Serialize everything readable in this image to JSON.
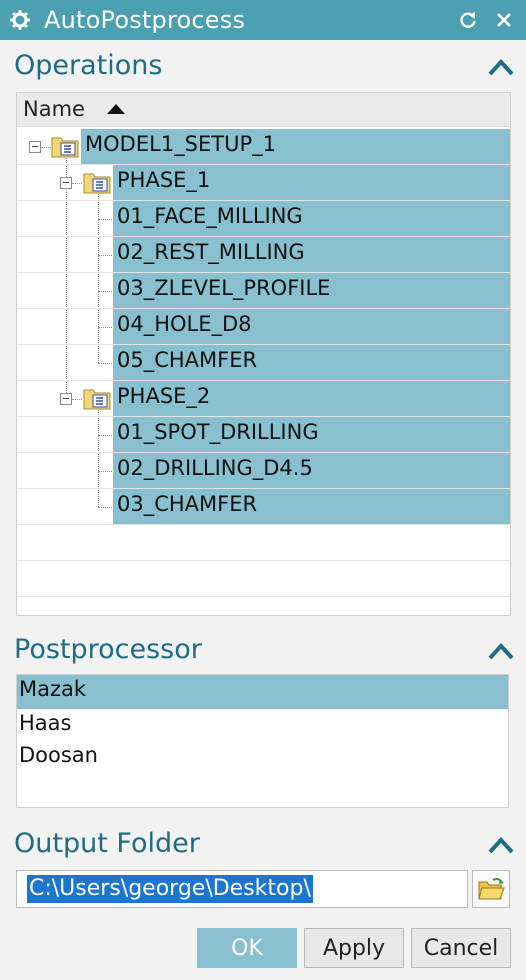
{
  "window": {
    "title": "AutoPostprocess",
    "title_bar_color": "#4a9fb0",
    "icons": [
      "gear-icon",
      "reset-icon",
      "close-icon"
    ]
  },
  "operations": {
    "section_title": "Operations",
    "column_header": "Name",
    "selection_color": "#89c0cf",
    "tree": {
      "root": "MODEL1_SETUP_1",
      "phases": [
        {
          "label": "PHASE_1",
          "ops": [
            "01_FACE_MILLING",
            "02_REST_MILLING",
            "03_ZLEVEL_PROFILE",
            "04_HOLE_D8",
            "05_CHAMFER"
          ]
        },
        {
          "label": "PHASE_2",
          "ops": [
            "01_SPOT_DRILLING",
            "02_DRILLING_D4.5",
            "03_CHAMFER"
          ]
        }
      ]
    }
  },
  "postprocessor": {
    "section_title": "Postprocessor",
    "items": [
      "Mazak",
      "Haas",
      "Doosan"
    ],
    "selected": "Mazak"
  },
  "output_folder": {
    "section_title": "Output Folder",
    "path": "C:\\Users\\george\\Desktop\\"
  },
  "buttons": {
    "ok": "OK",
    "apply": "Apply",
    "cancel": "Cancel"
  }
}
